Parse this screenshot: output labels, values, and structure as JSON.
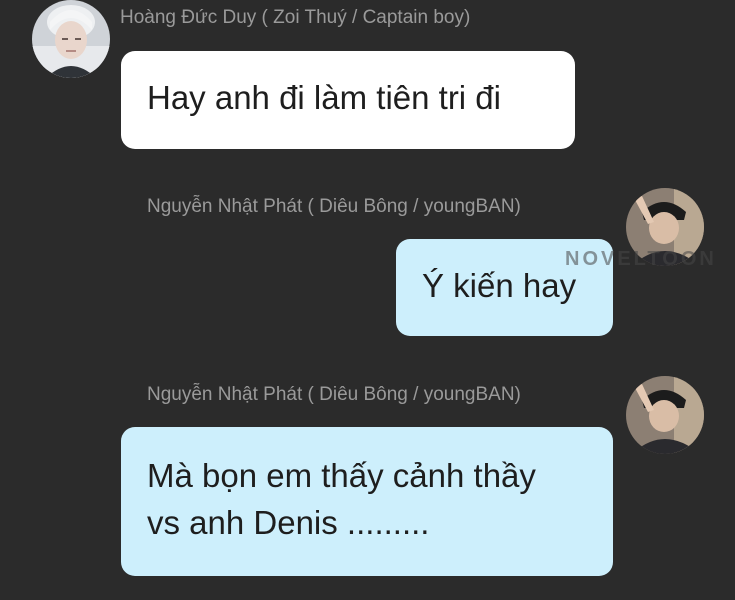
{
  "messages": [
    {
      "sender": "Hoàng Đức Duy ( Zoi Thuý / Captain boy)",
      "text": "Hay anh đi làm tiên tri đi",
      "side": "left",
      "bubble_color": "#ffffff"
    },
    {
      "sender": "Nguyễn Nhật Phát ( Diêu Bông / youngBAN)",
      "text": "Ý kiến hay",
      "side": "right",
      "bubble_color": "#cdeffc"
    },
    {
      "sender": "Nguyễn Nhật Phát ( Diêu Bông / youngBAN)",
      "text_lines": [
        "Mà bọn em thấy cảnh thầy",
        "vs anh Denis ........."
      ],
      "side": "right",
      "bubble_color": "#cdeffc"
    }
  ],
  "watermark": "NOVELTOON",
  "colors": {
    "background": "#2b2b2b",
    "sender_text": "#9a9a9a",
    "incoming_bubble": "#ffffff",
    "outgoing_bubble": "#cdeffc"
  }
}
